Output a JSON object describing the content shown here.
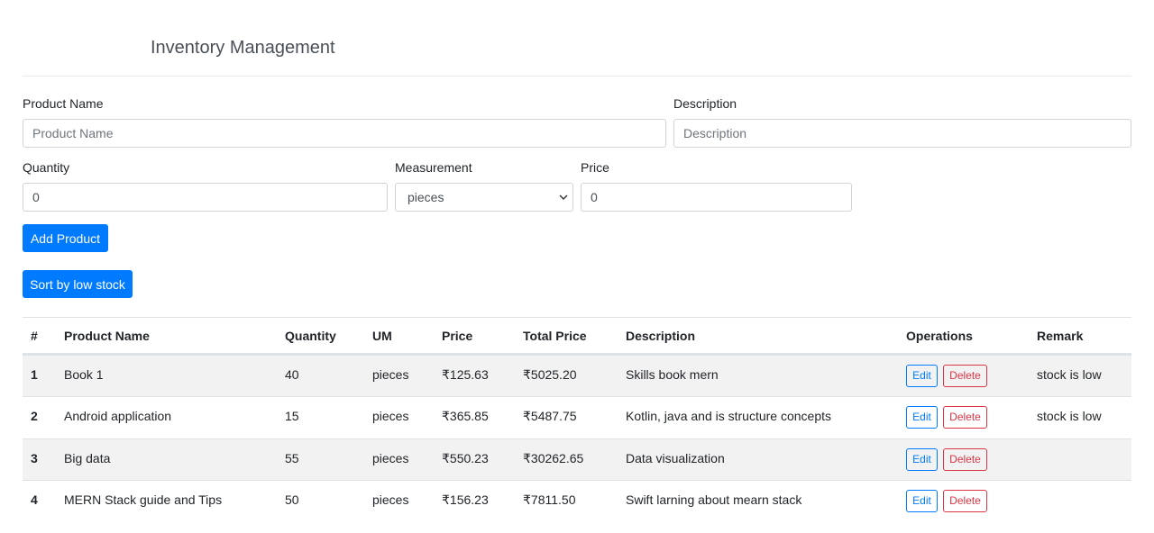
{
  "header": {
    "title": "Inventory Management"
  },
  "form": {
    "product_name": {
      "label": "Product Name",
      "placeholder": "Product Name",
      "value": ""
    },
    "description": {
      "label": "Description",
      "placeholder": "Description",
      "value": ""
    },
    "quantity": {
      "label": "Quantity",
      "value": "0"
    },
    "measurement": {
      "label": "Measurement",
      "selected": "pieces"
    },
    "price": {
      "label": "Price",
      "value": "0"
    },
    "add_button": "Add Product"
  },
  "sort_button": "Sort by low stock",
  "table": {
    "headers": [
      "#",
      "Product Name",
      "Quantity",
      "UM",
      "Price",
      "Total Price",
      "Description",
      "Operations",
      "Remark"
    ],
    "edit_label": "Edit",
    "delete_label": "Delete",
    "rows": [
      {
        "idx": "1",
        "name": "Book 1",
        "qty": "40",
        "um": "pieces",
        "price": "₹125.63",
        "total": "₹5025.20",
        "desc": "Skills book mern",
        "remark": "stock is low"
      },
      {
        "idx": "2",
        "name": "Android application",
        "qty": "15",
        "um": "pieces",
        "price": "₹365.85",
        "total": "₹5487.75",
        "desc": "Kotlin, java and is structure concepts",
        "remark": "stock is low"
      },
      {
        "idx": "3",
        "name": "Big data",
        "qty": "55",
        "um": "pieces",
        "price": "₹550.23",
        "total": "₹30262.65",
        "desc": "Data visualization",
        "remark": ""
      },
      {
        "idx": "4",
        "name": "MERN Stack guide and Tips",
        "qty": "50",
        "um": "pieces",
        "price": "₹156.23",
        "total": "₹7811.50",
        "desc": "Swift larning about mearn stack",
        "remark": ""
      }
    ]
  },
  "colors": {
    "primary": "#007bff",
    "danger": "#dc3545",
    "stripe": "#f2f2f2"
  }
}
